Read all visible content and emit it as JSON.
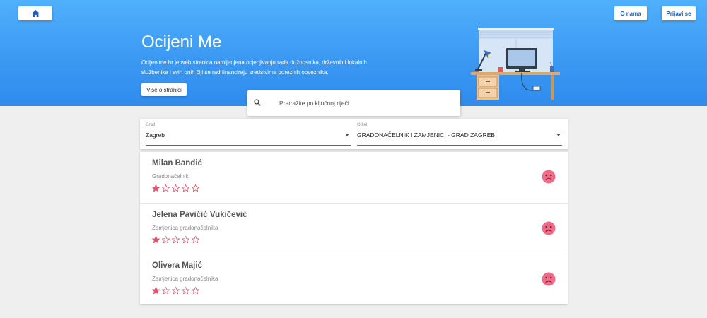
{
  "nav": {
    "home_icon": "home-icon",
    "about_label": "O nama",
    "login_label": "Prijavi se"
  },
  "hero": {
    "title": "Ocijeni Me",
    "description": "Ocijenime.hr je web stranica namijenjena ocjenjivanju rada dužnosnika, državnih i lokalnih službenika i svih onih čiji se rad financiraju sredstvima poreznih obveznika.",
    "more_label": "Više o stranici"
  },
  "search": {
    "placeholder": "Pretražite po ključnoj riječi",
    "icon": "search-icon"
  },
  "filters": {
    "city": {
      "label": "Grad",
      "value": "Zagreb"
    },
    "department": {
      "label": "Odjel",
      "value": "GRADONAČELNIK I ZAMJENICI - GRAD ZAGREB"
    }
  },
  "officials": [
    {
      "name": "Milan Bandić",
      "role": "Gradonačelnik",
      "rating": 1,
      "max_rating": 5,
      "mood_icon": "sad-face-icon"
    },
    {
      "name": "Jelena Pavičić Vukičević",
      "role": "Zamjenica gradonačelnika",
      "rating": 1,
      "max_rating": 5,
      "mood_icon": "sad-face-icon"
    },
    {
      "name": "Olivera Majić",
      "role": "Zamjenica gradonačelnika",
      "rating": 1,
      "max_rating": 5,
      "mood_icon": "sad-face-icon"
    }
  ],
  "colors": {
    "hero_top": "#4fb0fb",
    "hero_bottom": "#2f8cee",
    "accent_text": "#1e5fb3",
    "star": "#e2566f",
    "sad_face": "#f06b87"
  }
}
